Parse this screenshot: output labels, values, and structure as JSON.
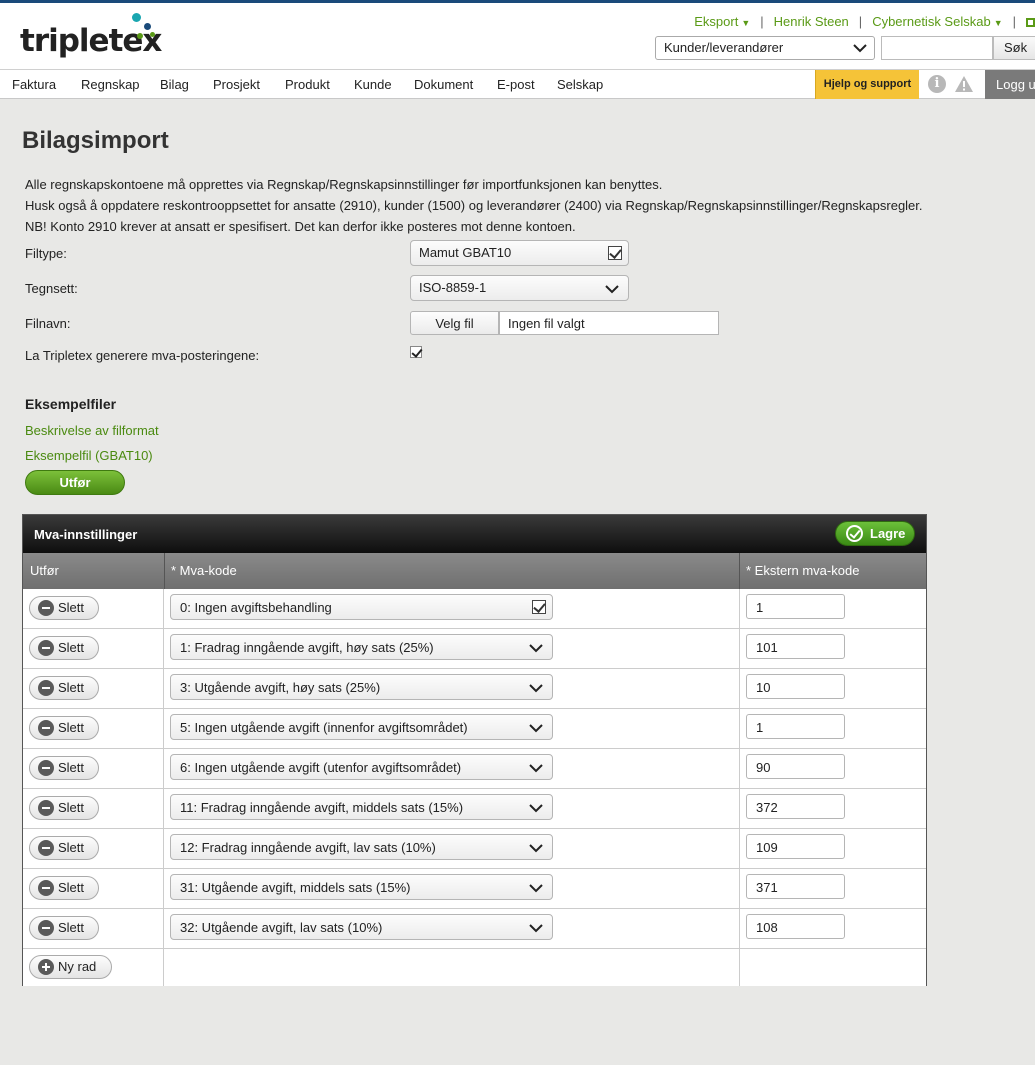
{
  "brand": {
    "name": "tripletex",
    "colors": {
      "green": "#5a9a16",
      "teal": "#1aa6b0",
      "navy": "#1a4a7a"
    }
  },
  "topbar": {
    "eksport": "Eksport",
    "user": "Henrik Steen",
    "company": "Cybernetisk Selskab",
    "search_scope": "Kunder/leverandører",
    "search_placeholder": "",
    "search_button": "Søk"
  },
  "nav": {
    "items": [
      "Faktura",
      "Regnskap",
      "Bilag",
      "Prosjekt",
      "Produkt",
      "Kunde",
      "Dokument",
      "E-post",
      "Selskap"
    ],
    "help": "Hjelp og support",
    "logout": "Logg ut",
    "help_color": "#f5c338"
  },
  "page": {
    "title": "Bilagsimport",
    "info": [
      "Alle regnskapskontoene må opprettes via Regnskap/Regnskapsinnstillinger før importfunksjonen kan benyttes.",
      "Husk også å oppdatere reskontrooppsettet for ansatte (2910), kunder (1500) og leverandører (2400) via Regnskap/Regnskapsinnstillinger/Regnskapsregler.",
      "NB! Konto 2910 krever at ansatt er spesifisert. Det kan derfor ikke posteres mot denne kontoen."
    ]
  },
  "form": {
    "filetype_label": "Filtype:",
    "filetype_value": "Mamut GBAT10",
    "charset_label": "Tegnsett:",
    "charset_value": "ISO-8859-1",
    "filename_label": "Filnavn:",
    "file_button": "Velg fil",
    "file_value": "Ingen fil valgt",
    "generate_label": "La Tripletex generere mva-posteringene:",
    "generate_checked": true
  },
  "examples": {
    "title": "Eksempelfiler",
    "link1": "Beskrivelse av filformat",
    "link2": "Eksempelfil (GBAT10)",
    "run_button": "Utfør"
  },
  "mva": {
    "title": "Mva-innstillinger",
    "save_button": "Lagre",
    "columns": [
      "Utfør",
      "* Mva-kode",
      "* Ekstern mva-kode"
    ],
    "delete_label": "Slett",
    "new_row_label": "Ny rad",
    "rows": [
      {
        "code": "0: Ingen avgiftsbehandling",
        "ext": "1"
      },
      {
        "code": "1: Fradrag inngående avgift, høy sats (25%)",
        "ext": "101"
      },
      {
        "code": "3: Utgående avgift, høy sats (25%)",
        "ext": "10"
      },
      {
        "code": "5: Ingen utgående avgift (innenfor avgiftsområdet)",
        "ext": "1"
      },
      {
        "code": "6: Ingen utgående avgift (utenfor avgiftsområdet)",
        "ext": "90"
      },
      {
        "code": "11: Fradrag inngående avgift, middels sats (15%)",
        "ext": "372"
      },
      {
        "code": "12: Fradrag inngående avgift, lav sats (10%)",
        "ext": "109"
      },
      {
        "code": "31: Utgående avgift, middels sats (15%)",
        "ext": "371"
      },
      {
        "code": "32: Utgående avgift, lav sats (10%)",
        "ext": "108"
      }
    ]
  }
}
